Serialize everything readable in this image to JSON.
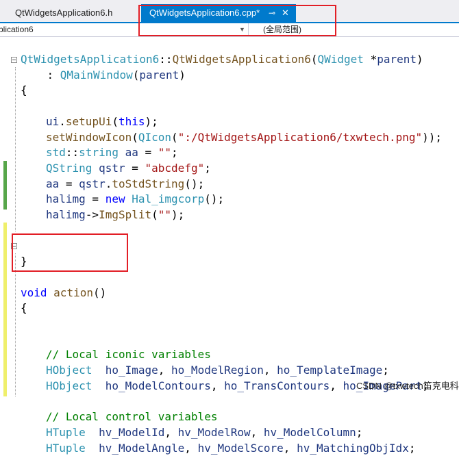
{
  "tabs": [
    {
      "label": "QtWidgetsApplication6.h",
      "active": false
    },
    {
      "label": "QtWidgetsApplication6.cpp*",
      "active": true,
      "pin_icon": "pin-icon",
      "close_icon": "close-icon"
    }
  ],
  "nav": {
    "project": "plication6",
    "scope": "(全局范围)"
  },
  "colors": {
    "keyword": "#0000ff",
    "type": "#2b91af",
    "string": "#a31515",
    "comment": "#008000",
    "function": "#74531f",
    "variable": "#1f377f",
    "accent": "#007acc",
    "highlight_box": "#e21e26",
    "change_saved": "#57a64a",
    "change_unsaved": "#efef6b"
  },
  "code": [
    [
      {
        "t": "QtWidgetsApplication6",
        "k": "type"
      },
      {
        "t": "::",
        "k": "plain"
      },
      {
        "t": "QtWidgetsApplication6",
        "k": "func"
      },
      {
        "t": "(",
        "k": "plain"
      },
      {
        "t": "QWidget",
        "k": "type"
      },
      {
        "t": " *",
        "k": "plain"
      },
      {
        "t": "parent",
        "k": "var"
      },
      {
        "t": ")",
        "k": "plain"
      }
    ],
    [
      {
        "t": "    : ",
        "k": "plain"
      },
      {
        "t": "QMainWindow",
        "k": "type"
      },
      {
        "t": "(",
        "k": "plain"
      },
      {
        "t": "parent",
        "k": "var"
      },
      {
        "t": ")",
        "k": "plain"
      }
    ],
    [
      {
        "t": "{",
        "k": "plain"
      }
    ],
    [],
    [
      {
        "t": "ui",
        "k": "var"
      },
      {
        "t": ".",
        "k": "plain"
      },
      {
        "t": "setupUi",
        "k": "func"
      },
      {
        "t": "(",
        "k": "plain"
      },
      {
        "t": "this",
        "k": "kw"
      },
      {
        "t": ");",
        "k": "plain"
      }
    ],
    [
      {
        "t": "setWindowIcon",
        "k": "func"
      },
      {
        "t": "(",
        "k": "plain"
      },
      {
        "t": "QIcon",
        "k": "type"
      },
      {
        "t": "(",
        "k": "plain"
      },
      {
        "t": "\":/QtWidgetsApplication6/txwtech.png\"",
        "k": "str"
      },
      {
        "t": "));",
        "k": "plain"
      }
    ],
    [
      {
        "t": "std",
        "k": "type"
      },
      {
        "t": "::",
        "k": "plain"
      },
      {
        "t": "string",
        "k": "type"
      },
      {
        "t": " ",
        "k": "plain"
      },
      {
        "t": "aa",
        "k": "var"
      },
      {
        "t": " = ",
        "k": "plain"
      },
      {
        "t": "\"\"",
        "k": "str"
      },
      {
        "t": ";",
        "k": "plain"
      }
    ],
    [
      {
        "t": "QString",
        "k": "type"
      },
      {
        "t": " ",
        "k": "plain"
      },
      {
        "t": "qstr",
        "k": "var"
      },
      {
        "t": " = ",
        "k": "plain"
      },
      {
        "t": "\"abcdefg\"",
        "k": "str"
      },
      {
        "t": ";",
        "k": "plain"
      }
    ],
    [
      {
        "t": "aa",
        "k": "var"
      },
      {
        "t": " = ",
        "k": "plain"
      },
      {
        "t": "qstr",
        "k": "var"
      },
      {
        "t": ".",
        "k": "plain"
      },
      {
        "t": "toStdString",
        "k": "func"
      },
      {
        "t": "();",
        "k": "plain"
      }
    ],
    [
      {
        "t": "halimg",
        "k": "var"
      },
      {
        "t": " = ",
        "k": "plain"
      },
      {
        "t": "new",
        "k": "kw"
      },
      {
        "t": " ",
        "k": "plain"
      },
      {
        "t": "Hal_imgcorp",
        "k": "type"
      },
      {
        "t": "();",
        "k": "plain"
      }
    ],
    [
      {
        "t": "halimg",
        "k": "var"
      },
      {
        "t": "->",
        "k": "plain"
      },
      {
        "t": "ImgSplit",
        "k": "func"
      },
      {
        "t": "(",
        "k": "plain"
      },
      {
        "t": "\"\"",
        "k": "str"
      },
      {
        "t": ");",
        "k": "plain"
      }
    ],
    [],
    [],
    [
      {
        "t": "}",
        "k": "plain"
      }
    ],
    [],
    [
      {
        "t": "void",
        "k": "kw"
      },
      {
        "t": " ",
        "k": "plain"
      },
      {
        "t": "action",
        "k": "func"
      },
      {
        "t": "()",
        "k": "plain"
      }
    ],
    [
      {
        "t": "{",
        "k": "plain"
      }
    ],
    [],
    [],
    [
      {
        "t": "// Local iconic variables",
        "k": "cmt"
      }
    ],
    [
      {
        "t": "HObject",
        "k": "type"
      },
      {
        "t": "  ",
        "k": "plain"
      },
      {
        "t": "ho_Image",
        "k": "var"
      },
      {
        "t": ", ",
        "k": "plain"
      },
      {
        "t": "ho_ModelRegion",
        "k": "var"
      },
      {
        "t": ", ",
        "k": "plain"
      },
      {
        "t": "ho_TemplateImage",
        "k": "var"
      },
      {
        "t": ";",
        "k": "plain"
      }
    ],
    [
      {
        "t": "HObject",
        "k": "type"
      },
      {
        "t": "  ",
        "k": "plain"
      },
      {
        "t": "ho_ModelContours",
        "k": "var"
      },
      {
        "t": ", ",
        "k": "plain"
      },
      {
        "t": "ho_TransContours",
        "k": "var"
      },
      {
        "t": ", ",
        "k": "plain"
      },
      {
        "t": "ho_ImagePart",
        "k": "var"
      },
      {
        "t": ";",
        "k": "plain"
      }
    ],
    [],
    [
      {
        "t": "// Local control variables",
        "k": "cmt"
      }
    ],
    [
      {
        "t": "HTuple",
        "k": "type"
      },
      {
        "t": "  ",
        "k": "plain"
      },
      {
        "t": "hv_ModelId",
        "k": "var"
      },
      {
        "t": ", ",
        "k": "plain"
      },
      {
        "t": "hv_ModelRow",
        "k": "var"
      },
      {
        "t": ", ",
        "k": "plain"
      },
      {
        "t": "hv_ModelColumn",
        "k": "var"
      },
      {
        "t": ";",
        "k": "plain"
      }
    ],
    [
      {
        "t": "HTuple",
        "k": "type"
      },
      {
        "t": "  ",
        "k": "plain"
      },
      {
        "t": "hv_ModelAngle",
        "k": "var"
      },
      {
        "t": ", ",
        "k": "plain"
      },
      {
        "t": "hv_ModelScore",
        "k": "var"
      },
      {
        "t": ", ",
        "k": "plain"
      },
      {
        "t": "hv_MatchingObjIdx",
        "k": "var"
      },
      {
        "t": ";",
        "k": "plain"
      }
    ]
  ],
  "watermark": "CSDN @txwtech笛克电科"
}
